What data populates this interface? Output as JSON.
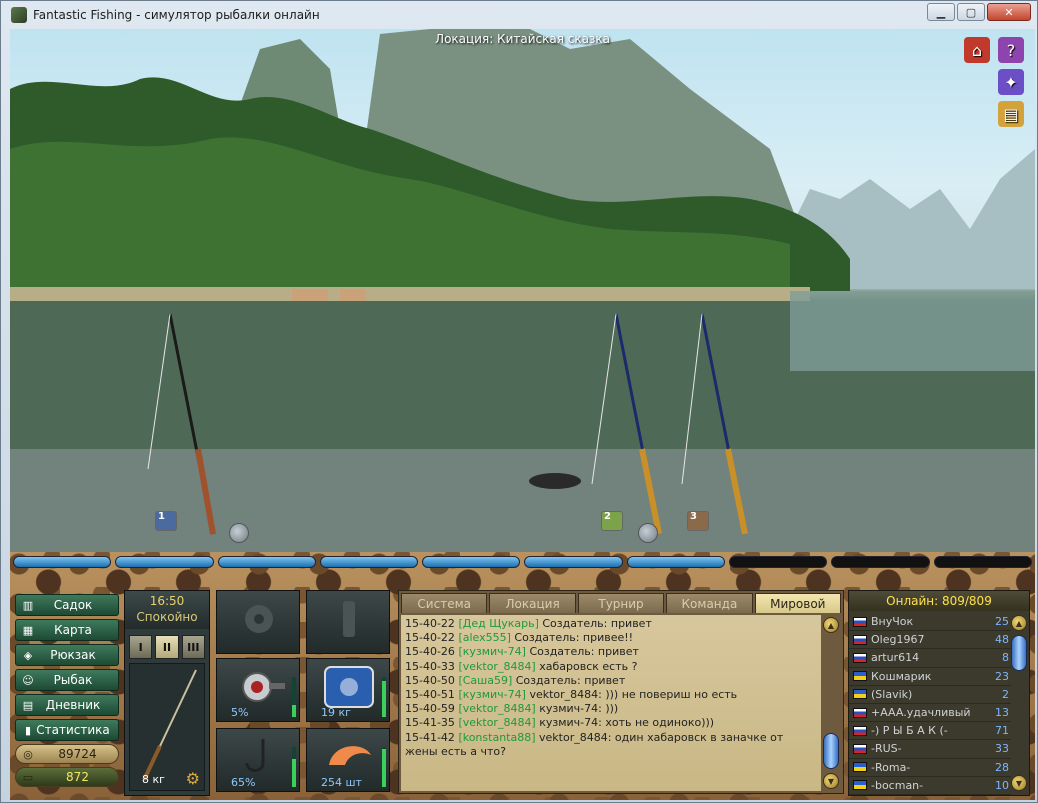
{
  "window": {
    "title": "Fantastic Fishing - симулятор рыбалки онлайн",
    "minimize": "▁",
    "maximize": "▢",
    "close": "✕"
  },
  "scene": {
    "location": "Локация: Китайская сказка",
    "side_icons": [
      {
        "name": "home-icon",
        "glyph": "⌂",
        "color": "#c0392b"
      },
      {
        "name": "help-book-icon",
        "glyph": "?",
        "color": "#8e44ad"
      },
      {
        "name": "gift-icon",
        "glyph": "✦",
        "color": "#6c4fc7"
      },
      {
        "name": "notes-icon",
        "glyph": "▤",
        "color": "#d4a23a"
      }
    ],
    "rod_markers": [
      {
        "label": "1",
        "color": "#4b6aa0"
      },
      {
        "label": "2",
        "color": "#7aa34a"
      },
      {
        "label": "3",
        "color": "#8b6a4a"
      }
    ]
  },
  "status": {
    "progress_filled": 7,
    "progress_total": 10
  },
  "menu": {
    "items": [
      {
        "label": "Садок",
        "icon": "▥"
      },
      {
        "label": "Карта",
        "icon": "▦"
      },
      {
        "label": "Рюкзак",
        "icon": "◈"
      },
      {
        "label": "Рыбак",
        "icon": "☺"
      },
      {
        "label": "Дневник",
        "icon": "▤"
      },
      {
        "label": "Статистика",
        "icon": "▮"
      }
    ],
    "silver": "89724",
    "gold": "872"
  },
  "tackle": {
    "time": "16:50",
    "state": "Спокойно",
    "rod_tabs": [
      "I",
      "II",
      "III"
    ],
    "active_rod": 1,
    "rod_weight": "8 кг"
  },
  "slots": {
    "reel_value": "5%",
    "reel_level": 0.3,
    "line_value": "19 кг",
    "line_level": 0.9,
    "line_brand": "KEVLI SNECK",
    "hook_value": "65%",
    "hook_level": 0.7,
    "bait_value": "254 шт",
    "bait_level": 0.95
  },
  "chat": {
    "tabs": [
      "Система",
      "Локация",
      "Турнир",
      "Команда",
      "Мировой"
    ],
    "active_tab": 4,
    "lines": [
      {
        "time": "15-40-22",
        "user": "[Дед Щукарь]",
        "text": "Создатель: привет"
      },
      {
        "time": "15-40-22",
        "user": "[alex555]",
        "text": "Создатель: привее!!"
      },
      {
        "time": "15-40-26",
        "user": "[кузмич-74]",
        "text": "Создатель: привет"
      },
      {
        "time": "15-40-33",
        "user": "[vektor_8484]",
        "text": "хабаровск есть ?"
      },
      {
        "time": "15-40-50",
        "user": "[Саша59]",
        "text": "Создатель: привет"
      },
      {
        "time": "15-40-51",
        "user": "[кузмич-74]",
        "text": "vektor_8484: ))) не повериш но есть"
      },
      {
        "time": "15-40-59",
        "user": "[vektor_8484]",
        "text": "кузмич-74: )))"
      },
      {
        "time": "15-41-35",
        "user": "[vektor_8484]",
        "text": "кузмич-74: хоть не одиноко)))"
      },
      {
        "time": "15-41-42",
        "user": "[konstanta88]",
        "text": "vektor_8484: один хабаровск в заначке от жены есть а что?"
      }
    ]
  },
  "online": {
    "header": "Онлайн: 809/809",
    "players": [
      {
        "flag": "ru",
        "name": "ВнуЧок",
        "level": "25"
      },
      {
        "flag": "ru",
        "name": "Oleg1967",
        "level": "48"
      },
      {
        "flag": "ru",
        "name": "artur614",
        "level": "8"
      },
      {
        "flag": "ua",
        "name": "Кошмарик",
        "level": "23"
      },
      {
        "flag": "ua",
        "name": "(Slavik)",
        "level": "2"
      },
      {
        "flag": "ru",
        "name": "+AAA.удачливый",
        "level": "13"
      },
      {
        "flag": "ru",
        "name": "-) Р Ы Б А К (-",
        "level": "71"
      },
      {
        "flag": "ru",
        "name": "-RUS-",
        "level": "33"
      },
      {
        "flag": "ua",
        "name": "-Roma-",
        "level": "28"
      },
      {
        "flag": "ua",
        "name": "-bocman-",
        "level": "10"
      }
    ]
  }
}
